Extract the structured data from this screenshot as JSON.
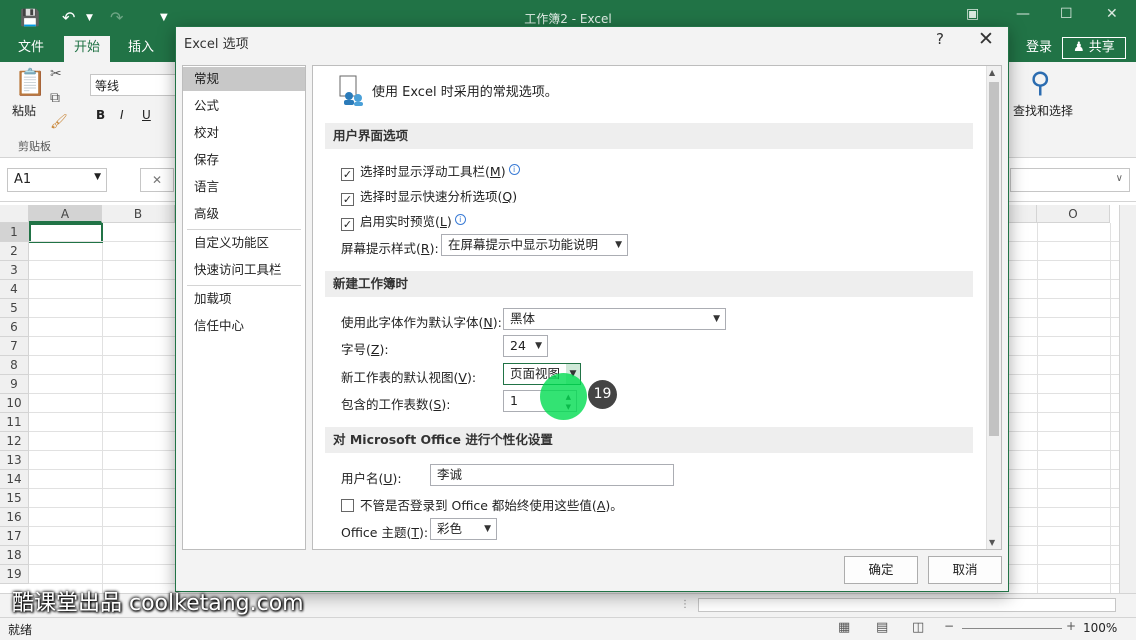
{
  "window": {
    "title": "工作簿2 - Excel"
  },
  "ribbon_tabs": [
    {
      "label": "文件"
    },
    {
      "label": "开始"
    },
    {
      "label": "插入"
    }
  ],
  "account": {
    "login": "登录",
    "share": "共享"
  },
  "ribbon": {
    "paste_label": "粘贴",
    "clipboard_group": "剪贴板",
    "font_name": "等线",
    "bold": "B",
    "italic": "I",
    "underline": "U",
    "find_select": "查找和选择"
  },
  "formula_bar": {
    "name_box": "A1",
    "cancel": "✕"
  },
  "columns": [
    "A",
    "B",
    "O"
  ],
  "rows": [
    "1",
    "2",
    "3",
    "4",
    "5",
    "6",
    "7",
    "8",
    "9",
    "10",
    "11",
    "12",
    "13",
    "14",
    "15",
    "16",
    "17",
    "18",
    "19"
  ],
  "status": {
    "ready": "就绪",
    "zoom": "100%"
  },
  "watermark": "酷课堂出品 coolketang.com",
  "dialog": {
    "title": "Excel 选项",
    "help": "?",
    "close": "✕",
    "nav": [
      "常规",
      "公式",
      "校对",
      "保存",
      "语言",
      "高级",
      "自定义功能区",
      "快速访问工具栏",
      "加载项",
      "信任中心"
    ],
    "header_text": "使用 Excel 时采用的常规选项。",
    "section_ui": "用户界面选项",
    "cb_mini_toolbar": "选择时显示浮动工具栏(",
    "cb_mini_toolbar_key": "M",
    "cb_quick_analysis": "选择时显示快速分析选项(",
    "cb_quick_analysis_key": "Q",
    "cb_live_preview": "启用实时预览(",
    "cb_live_preview_key": "L",
    "tooltip_style_label": "屏幕提示样式(",
    "tooltip_style_key": "R",
    "tooltip_style_value": "在屏幕提示中显示功能说明",
    "section_new_wb": "新建工作簿时",
    "font_label": "使用此字体作为默认字体(",
    "font_key": "N",
    "font_value": "黑体",
    "size_label": "字号(",
    "size_key": "Z",
    "size_value": "24",
    "view_label": "新工作表的默认视图(",
    "view_key": "V",
    "view_value": "页面视图",
    "sheets_label": "包含的工作表数(",
    "sheets_key": "S",
    "sheets_value": "1",
    "section_personal": "对 Microsoft Office 进行个性化设置",
    "username_label": "用户名(",
    "username_key": "U",
    "username_value": "李诚",
    "always_use_text": "不管是否登录到 Office 都始终使用这些值(",
    "always_use_key": "A",
    "theme_label": "Office 主题(",
    "theme_key": "T",
    "theme_value": "彩色",
    "ok": "确定",
    "cancel": "取消"
  },
  "step_badge": "19"
}
